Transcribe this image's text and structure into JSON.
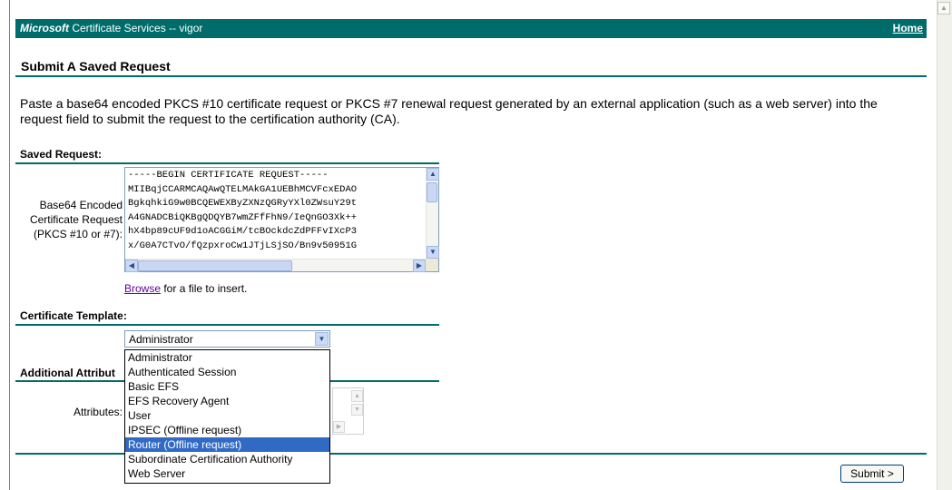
{
  "header": {
    "brand": "Microsoft",
    "service": " Certificate Services  --  vigor",
    "home_link": "Home"
  },
  "page": {
    "title": "Submit A Saved Request",
    "intro": "Paste a base64 encoded PKCS #10 certificate request or PKCS #7 renewal request generated by an external application (such as a web server) into the request field to submit the request to the certification authority (CA)."
  },
  "saved_request": {
    "section_title": "Saved Request:",
    "field_label_line1": "Base64 Encoded",
    "field_label_line2": "Certificate Request",
    "field_label_line3": "(PKCS #10 or #7):",
    "request_text": "-----BEGIN CERTIFICATE REQUEST-----\nMIIBqjCCARMCAQAwQTELMAkGA1UEBhMCVFcxEDAO\nBgkqhkiG9w0BCQEWEXByZXNzQGRyYXl0ZWsuY29t\nA4GNADCBiQKBgQDQYB7wmZFfFhN9/IeQnGO3Xk++\nhX4bp89cUF9d1oACGGiM/tcBOckdcZdPFFvIXcP3\nx/G0A7CTvO/fQzpxroCw1JTjLSjSO/Bn9v50951G",
    "browse_link": "Browse",
    "browse_suffix": " for a file to insert."
  },
  "certificate_template": {
    "section_title": "Certificate Template:",
    "selected": "Administrator",
    "options": [
      "Administrator",
      "Authenticated Session",
      "Basic EFS",
      "EFS Recovery Agent",
      "User",
      "IPSEC (Offline request)",
      "Router (Offline request)",
      "Subordinate Certification Authority",
      "Web Server"
    ],
    "highlighted_option": "Router (Offline request)"
  },
  "additional_attributes": {
    "section_title": "Additional Attribut",
    "field_label": "Attributes:"
  },
  "actions": {
    "submit_label": "Submit >"
  },
  "colors": {
    "header_bg": "#006b6b",
    "rule": "#006b6b",
    "selection": "#316ac5",
    "visited_link": "#660099"
  }
}
